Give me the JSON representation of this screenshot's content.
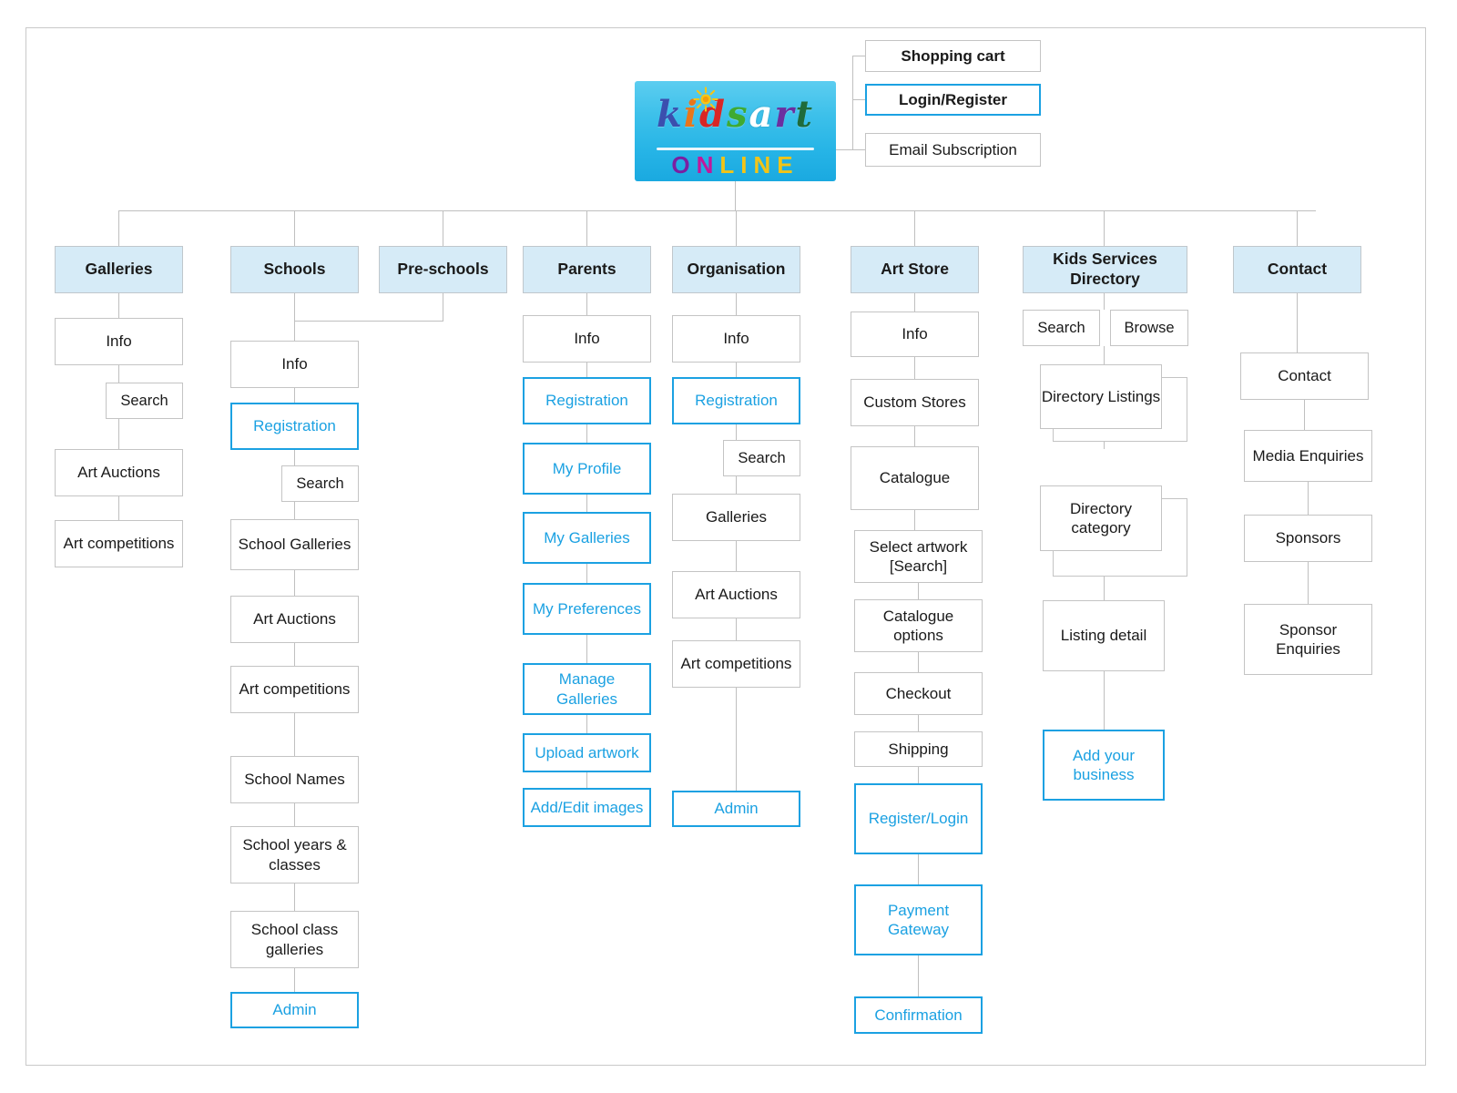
{
  "diagram": {
    "title": "kidsart ONLINE sitemap",
    "colors": {
      "accent_blue": "#1ba1e2",
      "header_fill": "#d6ebf7",
      "box_border": "#c4c4c4",
      "connector": "#bfbfbf"
    }
  },
  "logo": {
    "word_letters": [
      {
        "char": "k",
        "color": "#3b4fae"
      },
      {
        "char": "i",
        "color": "#e8761b"
      },
      {
        "char": "d",
        "color": "#d82626"
      },
      {
        "char": "s",
        "color": "#3faa32"
      },
      {
        "char": "a",
        "color": "#ffffff"
      },
      {
        "char": "r",
        "color": "#6b2fa0"
      },
      {
        "char": "t",
        "color": "#1f6b3a"
      }
    ],
    "subtitle_letters": [
      {
        "char": "O",
        "color": "#7b1fa2"
      },
      {
        "char": "N",
        "color": "#c2189b"
      },
      {
        "char": "L",
        "color": "#f2c416"
      },
      {
        "char": "I",
        "color": "#f2c416"
      },
      {
        "char": "N",
        "color": "#f2c416"
      },
      {
        "char": "E",
        "color": "#f2c416"
      }
    ],
    "sun_icon": "sun-icon",
    "sun_color": "#f5c518"
  },
  "top_links": [
    {
      "label": "Shopping cart",
      "style": "bold"
    },
    {
      "label": "Login/Register",
      "style": "blue-dark"
    },
    {
      "label": "Email Subscription",
      "style": "plain"
    }
  ],
  "columns": [
    {
      "id": "galleries",
      "header": "Galleries",
      "nodes": [
        {
          "label": "Info",
          "style": "plain"
        },
        {
          "label": "Search",
          "style": "plain"
        },
        {
          "label": "Art Auctions",
          "style": "plain"
        },
        {
          "label": "Art competitions",
          "style": "plain"
        }
      ]
    },
    {
      "id": "schools",
      "header": "Schools",
      "nodes": [
        {
          "label": "Info",
          "style": "plain"
        },
        {
          "label": "Registration",
          "style": "blue"
        },
        {
          "label": "Search",
          "style": "plain"
        },
        {
          "label": "School Galleries",
          "style": "plain"
        },
        {
          "label": "Art Auctions",
          "style": "plain"
        },
        {
          "label": "Art competitions",
          "style": "plain"
        },
        {
          "label": "School Names",
          "style": "plain"
        },
        {
          "label": "School years & classes",
          "style": "plain"
        },
        {
          "label": "School class galleries",
          "style": "plain"
        },
        {
          "label": "Admin",
          "style": "blue"
        }
      ]
    },
    {
      "id": "preschools",
      "header": "Pre-schools",
      "nodes": []
    },
    {
      "id": "parents",
      "header": "Parents",
      "nodes": [
        {
          "label": "Info",
          "style": "plain"
        },
        {
          "label": "Registration",
          "style": "blue"
        },
        {
          "label": "My Profile",
          "style": "blue"
        },
        {
          "label": "My Galleries",
          "style": "blue"
        },
        {
          "label": "My Preferences",
          "style": "blue"
        },
        {
          "label": "Manage Galleries",
          "style": "blue"
        },
        {
          "label": "Upload artwork",
          "style": "blue"
        },
        {
          "label": "Add/Edit images",
          "style": "blue"
        }
      ]
    },
    {
      "id": "organisation",
      "header": "Organisation",
      "nodes": [
        {
          "label": "Info",
          "style": "plain"
        },
        {
          "label": "Registration",
          "style": "blue"
        },
        {
          "label": "Search",
          "style": "plain"
        },
        {
          "label": "Galleries",
          "style": "plain"
        },
        {
          "label": "Art Auctions",
          "style": "plain"
        },
        {
          "label": "Art competitions",
          "style": "plain"
        },
        {
          "label": "Admin",
          "style": "blue"
        }
      ]
    },
    {
      "id": "artstore",
      "header": "Art Store",
      "nodes": [
        {
          "label": "Info",
          "style": "plain"
        },
        {
          "label": "Custom Stores",
          "style": "plain"
        },
        {
          "label": "Catalogue",
          "style": "plain"
        },
        {
          "label": "Select artwork [Search]",
          "style": "plain"
        },
        {
          "label": "Catalogue options",
          "style": "plain"
        },
        {
          "label": "Checkout",
          "style": "plain"
        },
        {
          "label": "Shipping",
          "style": "plain"
        },
        {
          "label": "Register/Login",
          "style": "blue"
        },
        {
          "label": "Payment Gateway",
          "style": "blue"
        },
        {
          "label": "Confirmation",
          "style": "blue"
        }
      ]
    },
    {
      "id": "kids-services-directory",
      "header": "Kids Services Directory",
      "nodes": [
        {
          "label": "Search",
          "style": "plain"
        },
        {
          "label": "Browse",
          "style": "plain"
        },
        {
          "label": "Directory Listings",
          "style": "stacked"
        },
        {
          "label": "Directory category",
          "style": "stacked"
        },
        {
          "label": "Listing detail",
          "style": "plain"
        },
        {
          "label": "Add your business",
          "style": "blue"
        }
      ]
    },
    {
      "id": "contact",
      "header": "Contact",
      "nodes": [
        {
          "label": "Contact",
          "style": "plain"
        },
        {
          "label": "Media Enquiries",
          "style": "plain"
        },
        {
          "label": "Sponsors",
          "style": "plain"
        },
        {
          "label": "Sponsor Enquiries",
          "style": "plain"
        }
      ]
    }
  ]
}
